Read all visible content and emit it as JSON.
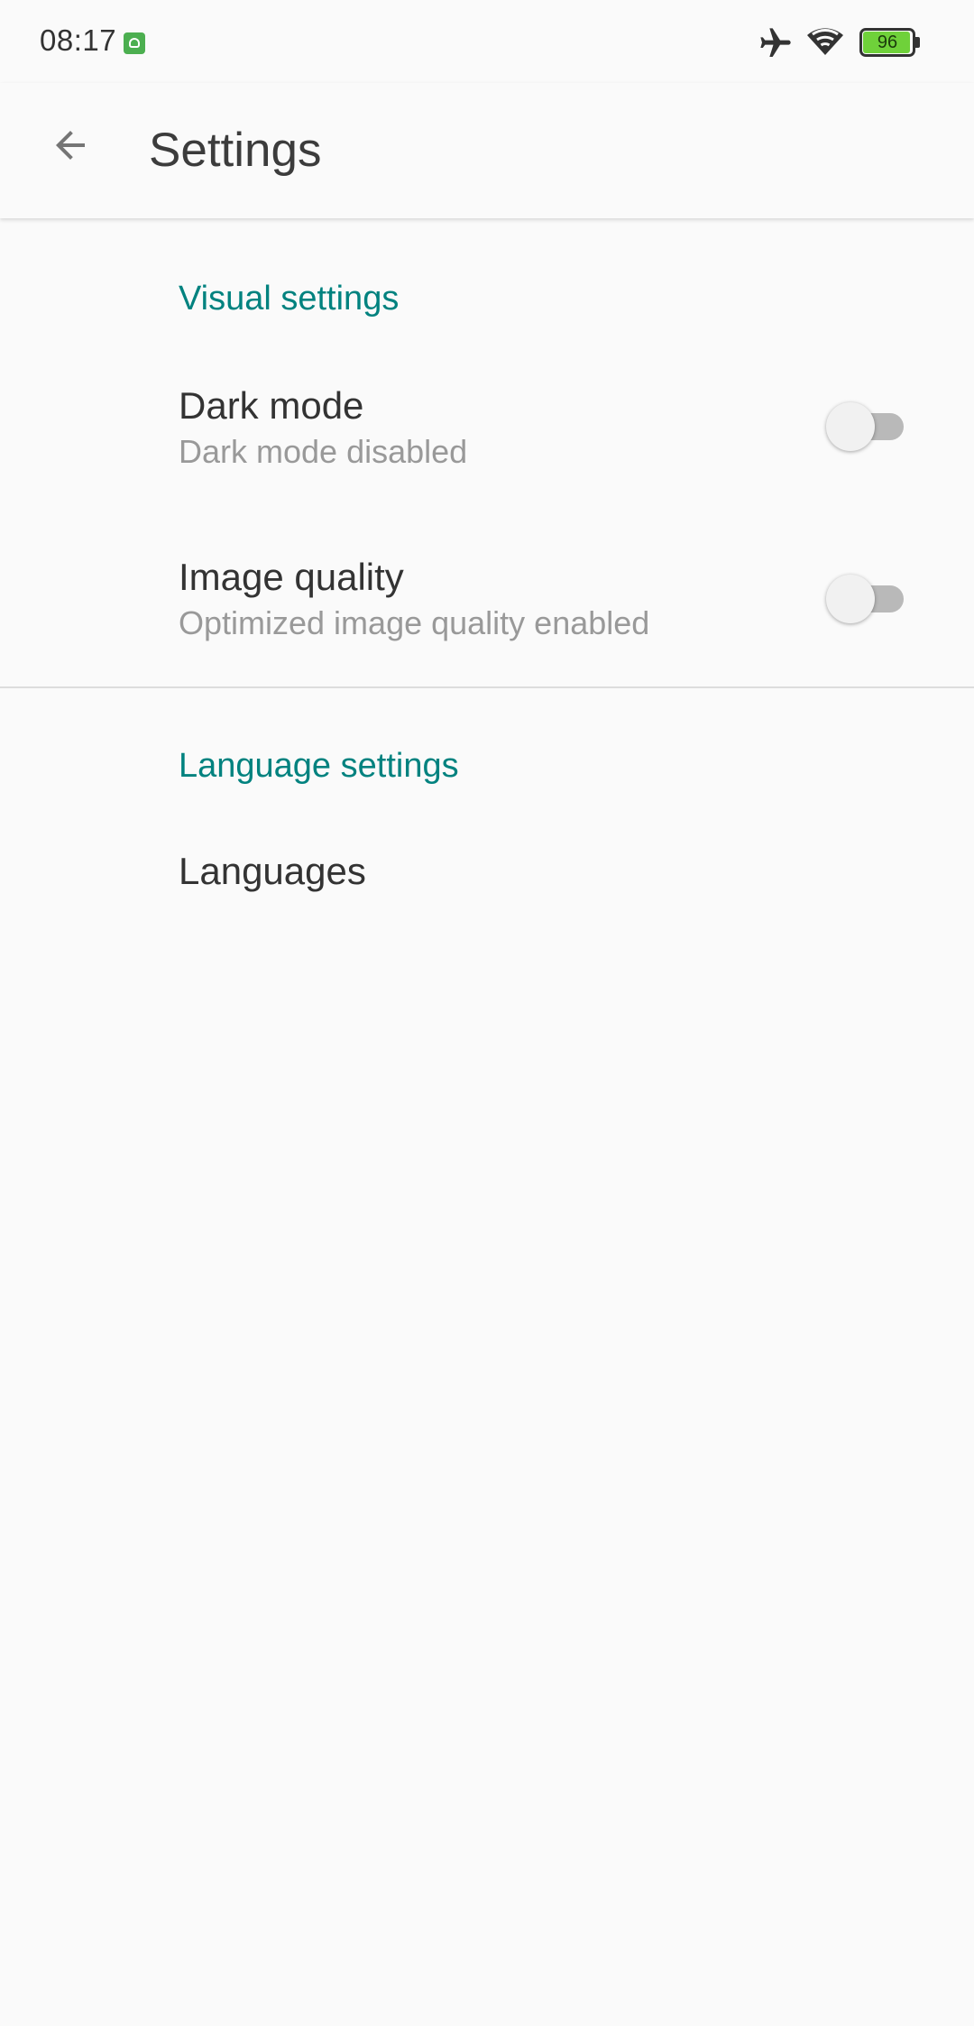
{
  "status_bar": {
    "time": "08:17",
    "battery_level": "96",
    "icons": [
      "app-notification-icon",
      "airplane-mode-icon",
      "wifi-icon",
      "battery-icon"
    ]
  },
  "app_bar": {
    "title": "Settings",
    "back_icon": "arrow-back-icon"
  },
  "sections": [
    {
      "header": "Visual settings",
      "items": [
        {
          "title": "Dark mode",
          "summary": "Dark mode disabled",
          "toggle_on": false
        },
        {
          "title": "Image quality",
          "summary": "Optimized image quality enabled",
          "toggle_on": false
        }
      ]
    },
    {
      "header": "Language settings",
      "items": [
        {
          "title": "Languages"
        }
      ]
    }
  ],
  "colors": {
    "accent": "#00827f",
    "background": "#fafafa",
    "battery_fill": "#6fd13a"
  }
}
